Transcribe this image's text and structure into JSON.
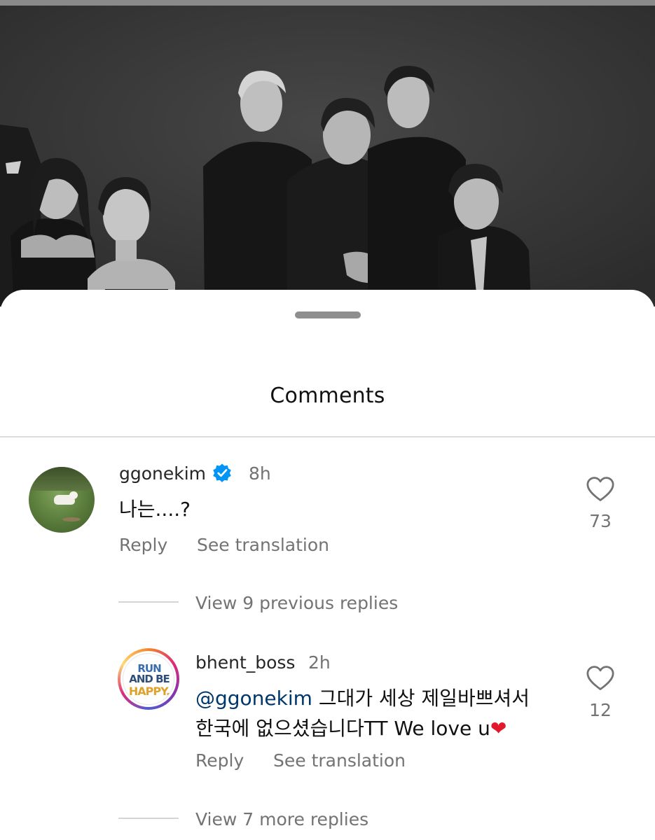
{
  "sheet": {
    "title": "Comments"
  },
  "comments": [
    {
      "username": "ggonekim",
      "verified": true,
      "time": "8h",
      "text": "나는....?",
      "reply_label": "Reply",
      "translate_label": "See translation",
      "likes": "73",
      "view_replies": "View 9 previous replies"
    },
    {
      "username": "bhent_boss",
      "time": "2h",
      "mention": "@ggonekim",
      "text_line1": " 그대가 세상 제일바쁘셔서",
      "text_line2": "한국에 없으셨습니다TT We love u",
      "emoji": "❤",
      "reply_label": "Reply",
      "translate_label": "See translation",
      "likes": "12",
      "view_replies": "View 7 more replies"
    }
  ],
  "avatar_logo": {
    "line1": "RUN",
    "line2": "AND BE",
    "line3": "HAPPY."
  },
  "colors": {
    "verified": "#0095f6",
    "heart_emoji": "#e0192b",
    "mention": "#00376b"
  }
}
